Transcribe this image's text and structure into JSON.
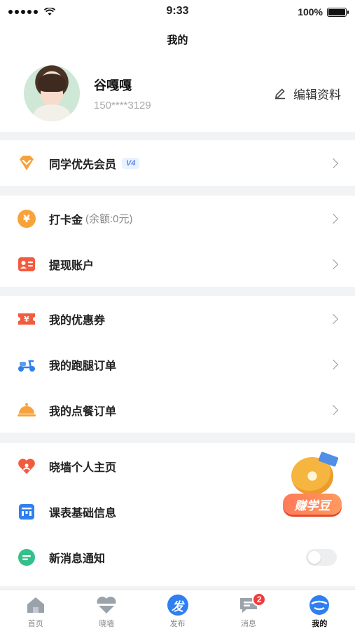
{
  "status_bar": {
    "time": "9:33",
    "battery": "100%"
  },
  "nav": {
    "title": "我的"
  },
  "profile": {
    "name": "谷嘎嘎",
    "phone": "150****3129",
    "edit_label": "编辑资料"
  },
  "vip": {
    "label": "同学优先会员",
    "badge": "V4"
  },
  "wallet": {
    "checkin_label": "打卡金",
    "checkin_balance": "(余额:0元)",
    "withdraw_label": "提现账户"
  },
  "orders": {
    "coupons": "我的优惠券",
    "errand_orders": "我的跑腿订单",
    "food_orders": "我的点餐订单"
  },
  "more": {
    "homepage": "晓墙个人主页",
    "schedule": "课表基础信息",
    "notifications": "新消息通知",
    "notifications_enabled": false
  },
  "promo": {
    "label": "赚学豆"
  },
  "tabs": [
    {
      "label": "首页",
      "icon": "home-icon"
    },
    {
      "label": "晓墙",
      "icon": "heart-wall-icon"
    },
    {
      "label": "发布",
      "icon": "publish-icon",
      "glyph": "发"
    },
    {
      "label": "消息",
      "icon": "message-icon",
      "badge": "2"
    },
    {
      "label": "我的",
      "icon": "profile-icon"
    }
  ],
  "colors": {
    "accent_blue": "#2f7ff0",
    "orange": "#f7a23a",
    "red": "#f35b3f",
    "green": "#34c08b",
    "badge_red": "#f23b3b"
  }
}
